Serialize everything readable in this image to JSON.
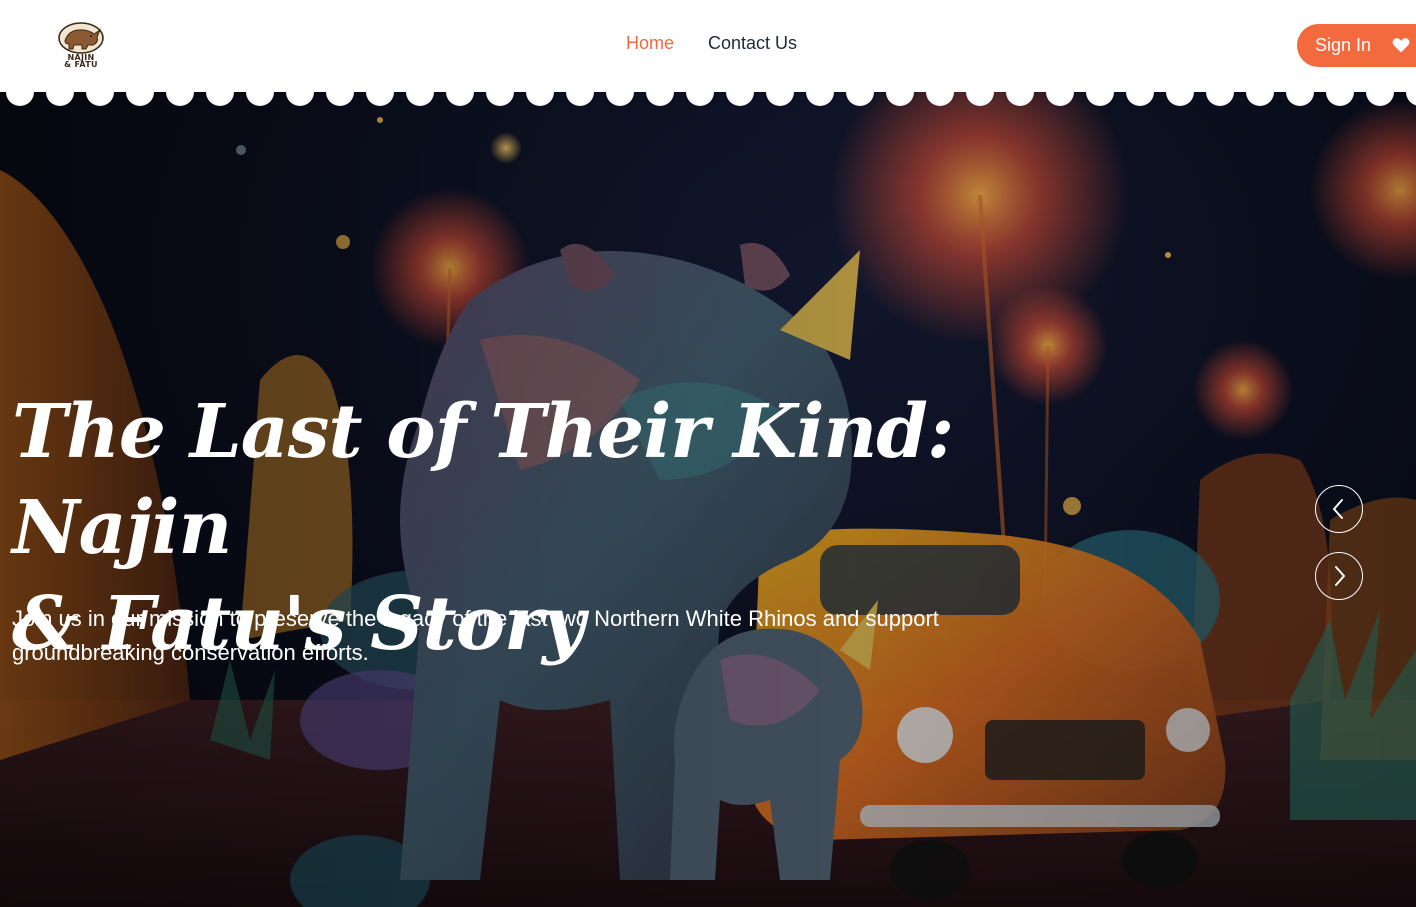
{
  "brand": {
    "logo_line1": "NAJIN",
    "logo_line2": "& FATU"
  },
  "nav": {
    "items": [
      {
        "label": "Home",
        "active": true
      },
      {
        "label": "Contact Us",
        "active": false
      }
    ]
  },
  "header_actions": {
    "signin_label": "Sign In",
    "heart_icon": "heart-icon"
  },
  "hero": {
    "headline_line1": "The Last of Their Kind: Najin",
    "headline_line2": "& Fatu's Story",
    "subtext": "Join us in our mission to preserve the legacy of the last two Northern White Rhinos and support groundbreaking conservation efforts.",
    "prev_icon": "chevron-left-icon",
    "next_icon": "chevron-right-icon"
  },
  "colors": {
    "accent": "#f26a3d",
    "nav_text": "#1c2a3a",
    "header_bg": "#ffffff",
    "hero_text": "#ffffff"
  }
}
